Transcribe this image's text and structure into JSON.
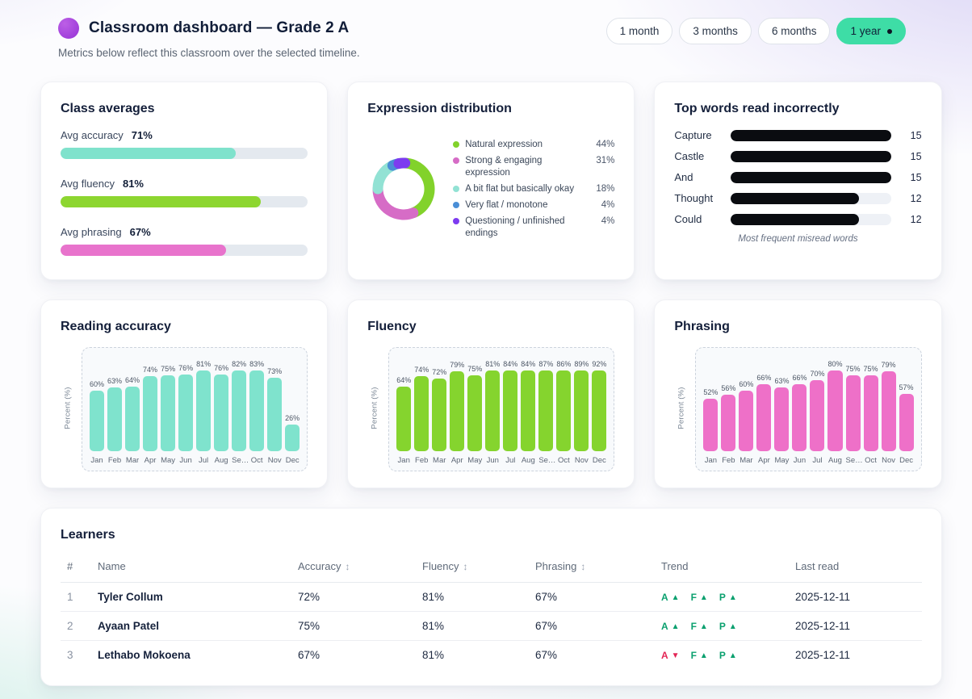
{
  "header": {
    "title": "Classroom dashboard — Grade 2 A",
    "subtitle": "Metrics below reflect this classroom over the selected timeline.",
    "logo_color": "#a24ade",
    "timeline_options": [
      {
        "label": "1 month",
        "selected": false
      },
      {
        "label": "3 months",
        "selected": false
      },
      {
        "label": "6 months",
        "selected": false
      },
      {
        "label": "1 year",
        "selected": true
      }
    ],
    "selected_pill_color": "#3edda6"
  },
  "class_averages": {
    "title": "Class averages",
    "track_color": "#e4e9ef",
    "metrics": [
      {
        "label": "Avg accuracy",
        "value": "71%",
        "percent": 71,
        "color": "#7fe2cc"
      },
      {
        "label": "Avg fluency",
        "value": "81%",
        "percent": 81,
        "color": "#8dd630"
      },
      {
        "label": "Avg phrasing",
        "value": "67%",
        "percent": 67,
        "color": "#e873cc"
      }
    ]
  },
  "chart_data": [
    {
      "id": "expression_distribution",
      "type": "pie",
      "donut": true,
      "title": "Expression distribution",
      "legend_position": "right",
      "slices": [
        {
          "label": "Natural expression",
          "value": 44,
          "color": "#82d22b"
        },
        {
          "label": "Strong & engaging expression",
          "value": 31,
          "color": "#d66cc6"
        },
        {
          "label": "A bit flat but basically okay",
          "value": 18,
          "color": "#92e2d4"
        },
        {
          "label": "Very flat / monotone",
          "value": 4,
          "color": "#4a8ed6"
        },
        {
          "label": "Questioning / unfinished endings",
          "value": 4,
          "color": "#7d3bf0"
        }
      ]
    },
    {
      "id": "top_words",
      "type": "bar",
      "orientation": "horizontal",
      "title": "Top words read incorrectly",
      "caption": "Most frequent misread words",
      "categories": [
        "Capture",
        "Castle",
        "And",
        "Thought",
        "Could"
      ],
      "values": [
        15,
        15,
        15,
        12,
        12
      ],
      "xlim": [
        0,
        15
      ],
      "bar_color": "#0a0c10",
      "track_color": "#eef1f6"
    },
    {
      "id": "reading_accuracy",
      "type": "bar",
      "title": "Reading accuracy",
      "ylabel": "Percent (%)",
      "value_suffix": "%",
      "categories": [
        "Jan",
        "Feb",
        "Mar",
        "Apr",
        "May",
        "Jun",
        "Jul",
        "Aug",
        "Se…",
        "Oct",
        "Nov",
        "Dec"
      ],
      "values": [
        60,
        63,
        64,
        74,
        75,
        76,
        81,
        76,
        82,
        83,
        73,
        26
      ],
      "bar_color": "#7fe3cd",
      "ylim": [
        0,
        100
      ]
    },
    {
      "id": "fluency",
      "type": "bar",
      "title": "Fluency",
      "ylabel": "Percent (%)",
      "value_suffix": "%",
      "categories": [
        "Jan",
        "Feb",
        "Mar",
        "Apr",
        "May",
        "Jun",
        "Jul",
        "Aug",
        "Se…",
        "Oct",
        "Nov",
        "Dec"
      ],
      "values": [
        64,
        74,
        72,
        79,
        75,
        81,
        84,
        84,
        87,
        86,
        89,
        92
      ],
      "bar_color": "#85d42e",
      "ylim": [
        0,
        100
      ]
    },
    {
      "id": "phrasing",
      "type": "bar",
      "title": "Phrasing",
      "ylabel": "Percent (%)",
      "value_suffix": "%",
      "categories": [
        "Jan",
        "Feb",
        "Mar",
        "Apr",
        "May",
        "Jun",
        "Jul",
        "Aug",
        "Se…",
        "Oct",
        "Nov",
        "Dec"
      ],
      "values": [
        52,
        56,
        60,
        66,
        63,
        66,
        70,
        80,
        75,
        75,
        79,
        57
      ],
      "bar_color": "#ee70c8",
      "ylim": [
        0,
        100
      ]
    }
  ],
  "learners": {
    "title": "Learners",
    "sort_icon": "↕",
    "up_glyph": "▲",
    "down_glyph": "▼",
    "trend_up_color": "#0aa06e",
    "trend_down_color": "#e32555",
    "columns": [
      {
        "label": "#",
        "sortable": false
      },
      {
        "label": "Name",
        "sortable": false
      },
      {
        "label": "Accuracy",
        "sortable": true
      },
      {
        "label": "Fluency",
        "sortable": true
      },
      {
        "label": "Phrasing",
        "sortable": true
      },
      {
        "label": "Trend",
        "sortable": false
      },
      {
        "label": "Last read",
        "sortable": false
      }
    ],
    "rows": [
      {
        "num": "1",
        "name": "Tyler Collum",
        "accuracy": "72%",
        "fluency": "81%",
        "phrasing": "67%",
        "trend": [
          {
            "letter": "A",
            "dir": "up"
          },
          {
            "letter": "F",
            "dir": "up"
          },
          {
            "letter": "P",
            "dir": "up"
          }
        ],
        "last_read": "2025-12-11"
      },
      {
        "num": "2",
        "name": "Ayaan Patel",
        "accuracy": "75%",
        "fluency": "81%",
        "phrasing": "67%",
        "trend": [
          {
            "letter": "A",
            "dir": "up"
          },
          {
            "letter": "F",
            "dir": "up"
          },
          {
            "letter": "P",
            "dir": "up"
          }
        ],
        "last_read": "2025-12-11"
      },
      {
        "num": "3",
        "name": "Lethabo Mokoena",
        "accuracy": "67%",
        "fluency": "81%",
        "phrasing": "67%",
        "trend": [
          {
            "letter": "A",
            "dir": "down"
          },
          {
            "letter": "F",
            "dir": "up"
          },
          {
            "letter": "P",
            "dir": "up"
          }
        ],
        "last_read": "2025-12-11"
      }
    ]
  }
}
